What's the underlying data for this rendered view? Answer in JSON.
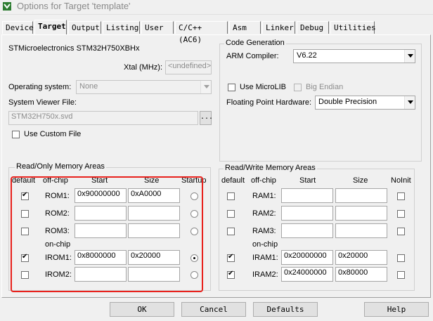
{
  "window": {
    "title": "Options for Target 'template'"
  },
  "tabs": [
    "Device",
    "Target",
    "Output",
    "Listing",
    "User",
    "C/C++ (AC6)",
    "Asm",
    "Linker",
    "Debug",
    "Utilities"
  ],
  "active_tab": "Target",
  "target": {
    "device_name": "STMicroelectronics STM32H750XBHx",
    "xtal_label": "Xtal (MHz):",
    "xtal_value": "<undefined>",
    "os_label": "Operating system:",
    "os_value": "None",
    "svd_label": "System Viewer File:",
    "svd_value": "STM32H750x.svd",
    "svd_browse": "...",
    "custom_file_label": "Use Custom File",
    "custom_file_checked": false
  },
  "code_gen": {
    "title": "Code Generation",
    "compiler_label": "ARM Compiler:",
    "compiler_value": "V6.22",
    "microlib_label": "Use MicroLIB",
    "microlib_checked": false,
    "big_endian_label": "Big Endian",
    "big_endian_checked": false,
    "fp_label": "Floating Point Hardware:",
    "fp_value": "Double Precision"
  },
  "rom": {
    "title": "Read/Only Memory Areas",
    "headers": {
      "default": "default",
      "offchip": "off-chip",
      "start": "Start",
      "size": "Size",
      "startup": "Startup"
    },
    "onchip_label": "on-chip",
    "rows": [
      {
        "label": "ROM1:",
        "default": true,
        "start": "0x90000000",
        "size": "0xA0000",
        "startup": false
      },
      {
        "label": "ROM2:",
        "default": false,
        "start": "",
        "size": "",
        "startup": false
      },
      {
        "label": "ROM3:",
        "default": false,
        "start": "",
        "size": "",
        "startup": false
      },
      {
        "label": "IROM1:",
        "default": true,
        "start": "0x8000000",
        "size": "0x20000",
        "startup": true
      },
      {
        "label": "IROM2:",
        "default": false,
        "start": "",
        "size": "",
        "startup": false
      }
    ]
  },
  "ram": {
    "title": "Read/Write Memory Areas",
    "headers": {
      "default": "default",
      "offchip": "off-chip",
      "start": "Start",
      "size": "Size",
      "noinit": "NoInit"
    },
    "onchip_label": "on-chip",
    "rows": [
      {
        "label": "RAM1:",
        "default": false,
        "start": "",
        "size": "",
        "noinit": false
      },
      {
        "label": "RAM2:",
        "default": false,
        "start": "",
        "size": "",
        "noinit": false
      },
      {
        "label": "RAM3:",
        "default": false,
        "start": "",
        "size": "",
        "noinit": false
      },
      {
        "label": "IRAM1:",
        "default": true,
        "start": "0x20000000",
        "size": "0x20000",
        "noinit": false
      },
      {
        "label": "IRAM2:",
        "default": true,
        "start": "0x24000000",
        "size": "0x80000",
        "noinit": false
      }
    ]
  },
  "buttons": {
    "ok": "OK",
    "cancel": "Cancel",
    "defaults": "Defaults",
    "help": "Help"
  },
  "colors": {
    "highlight": "#e8211c",
    "dialog_bg": "#f0f0f0"
  }
}
